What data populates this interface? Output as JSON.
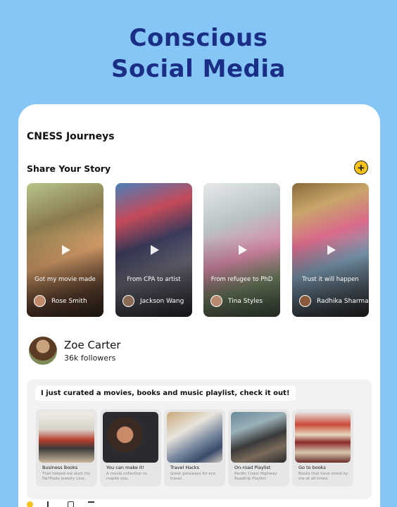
{
  "hero": {
    "line1": "Conscious",
    "line2": "Social Media"
  },
  "app": {
    "section_title": "CNESS Journeys",
    "share_title": "Share Your Story",
    "add_icon": "plus-icon",
    "add_symbol": "+"
  },
  "stories": [
    {
      "caption": "Got my movie made",
      "author": "Rose Smith"
    },
    {
      "caption": "From CPA to artist",
      "author": "Jackson Wang"
    },
    {
      "caption": "From refugee to PhD",
      "author": "Tina Styles"
    },
    {
      "caption": "Trust it will happen",
      "author": "Radhika Sharma"
    }
  ],
  "profile": {
    "name": "Zoe Carter",
    "followers": "36k followers"
  },
  "post": {
    "text": "I just curated a movies, books and music playlist, check it out!",
    "items": [
      {
        "title": "Business Books",
        "desc": "That helped me start my FairTrade Jewelry Line."
      },
      {
        "title": "You can make it!",
        "desc": "A movie collection to inspire you."
      },
      {
        "title": "Travel Hacks",
        "desc": "Great getaways for eco travel."
      },
      {
        "title": "On-road Playlist",
        "desc": "Pacific Coast Highway Roadtrip Playlist."
      },
      {
        "title": "Go to books",
        "desc": "Books that have stood by me at all times."
      }
    ]
  },
  "colors": {
    "background": "#86c6f6",
    "title": "#1b2e86",
    "accent": "#f7c31b"
  }
}
